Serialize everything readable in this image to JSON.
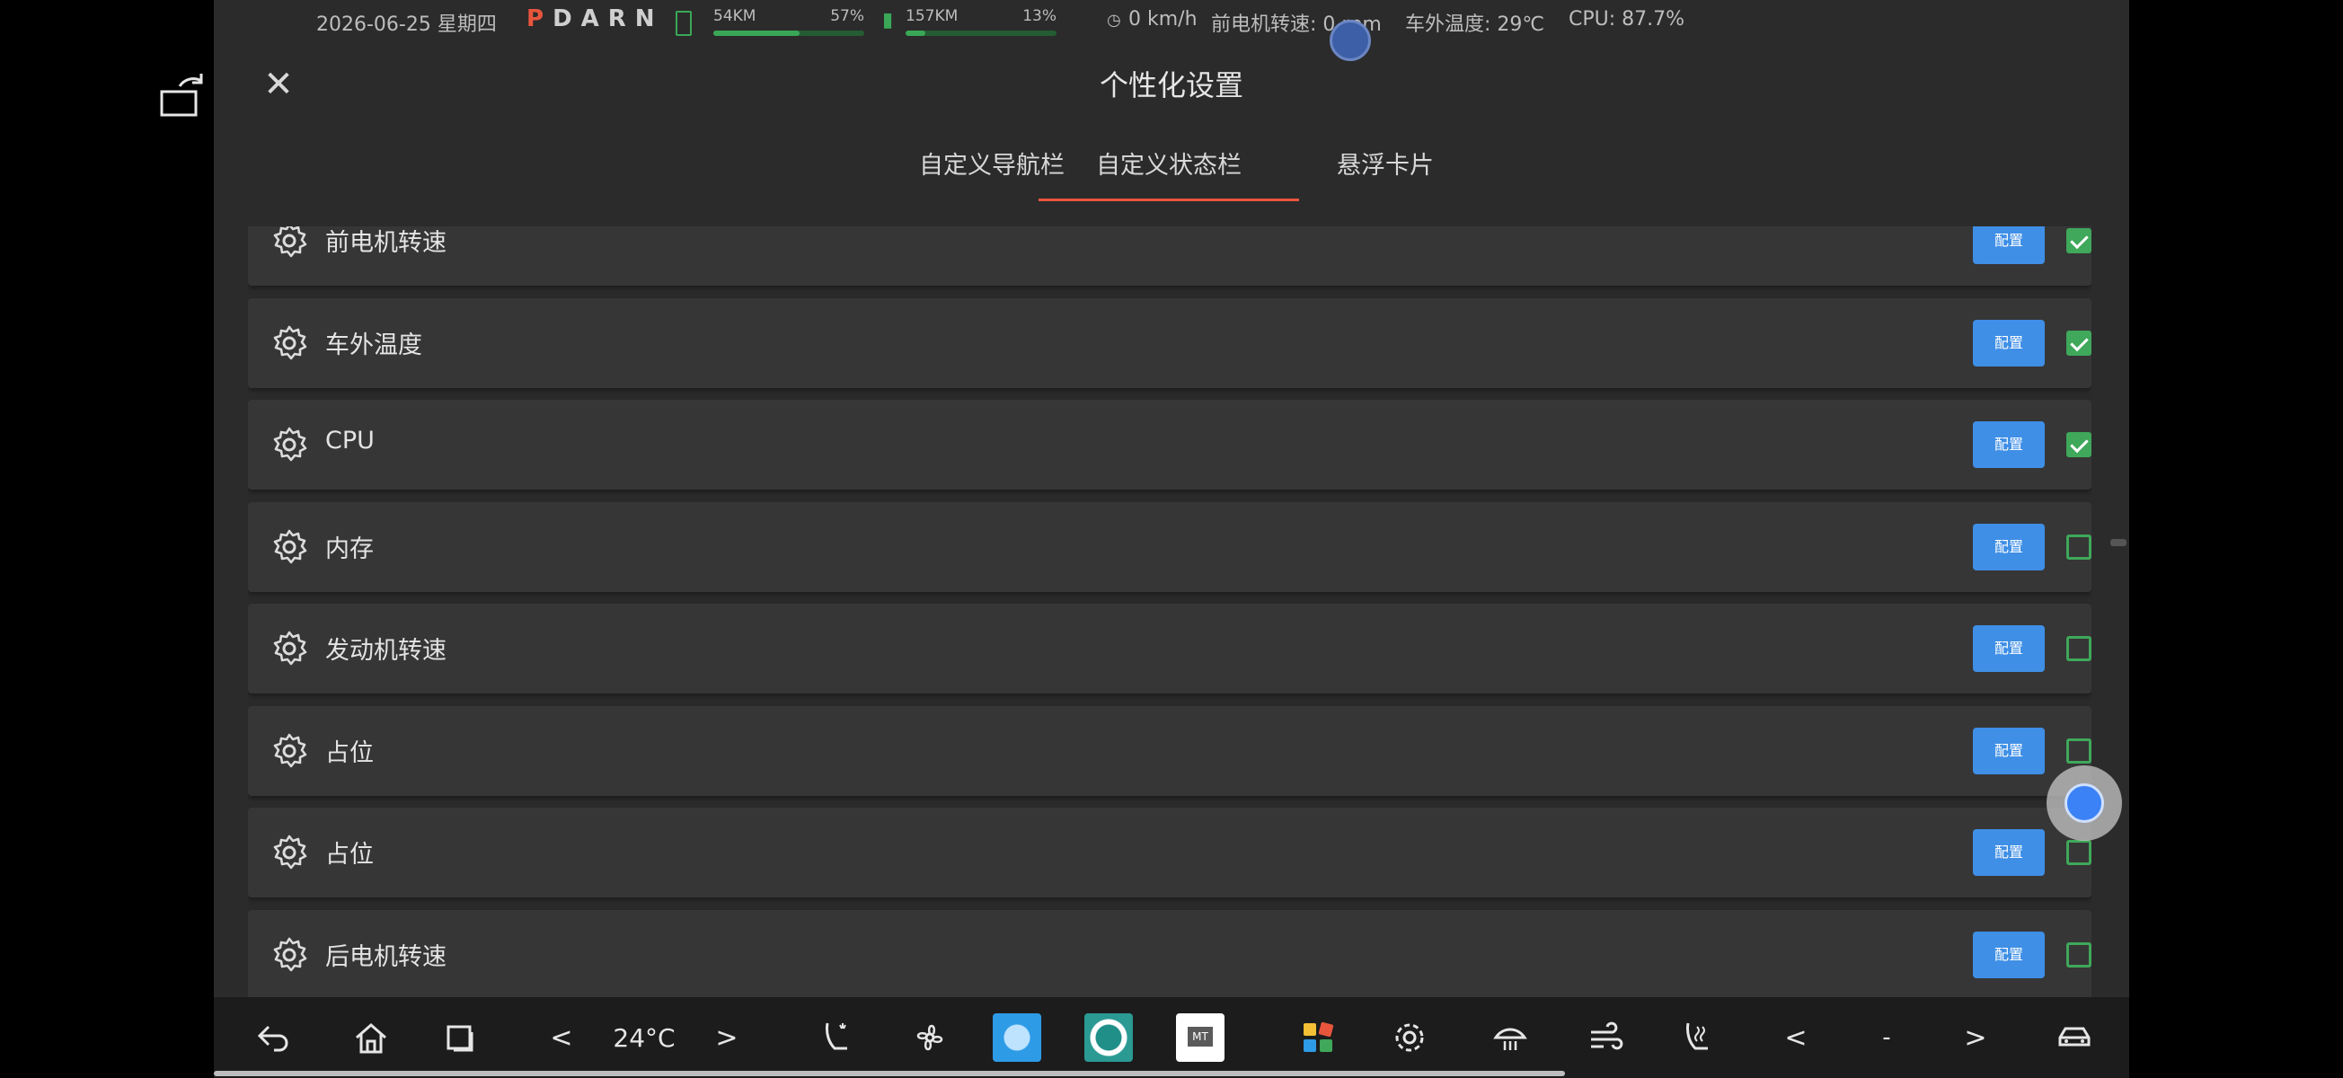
{
  "status_bar": {
    "datetime": "2026-06-25 星期四",
    "gear": {
      "active": "P",
      "others": "DARN"
    },
    "battery1": {
      "range": "54KM",
      "percent_label": "57%",
      "level": 0.57
    },
    "battery2": {
      "range": "157KM",
      "percent_label": "13%",
      "level": 0.13
    },
    "speed_icon": "speedometer-icon",
    "speed": "0 km/h",
    "front_motor": "前电机转速: 0 rpm",
    "outside_temp": "车外温度: 29℃",
    "cpu": "CPU: 87.7%"
  },
  "header": {
    "close_icon": "close-icon",
    "title": "个性化设置"
  },
  "tabs": [
    {
      "label": "自定义导航栏",
      "active": false
    },
    {
      "label": "自定义状态栏",
      "active": true
    },
    {
      "label": "悬浮卡片",
      "active": false
    }
  ],
  "items": [
    {
      "label": "前电机转速",
      "config_label": "配置",
      "checked": true
    },
    {
      "label": "车外温度",
      "config_label": "配置",
      "checked": true
    },
    {
      "label": "CPU",
      "config_label": "配置",
      "checked": true
    },
    {
      "label": "内存",
      "config_label": "配置",
      "checked": false
    },
    {
      "label": "发动机转速",
      "config_label": "配置",
      "checked": false
    },
    {
      "label": "占位",
      "config_label": "配置",
      "checked": false
    },
    {
      "label": "占位",
      "config_label": "配置",
      "checked": false
    },
    {
      "label": "后电机转速",
      "config_label": "配置",
      "checked": false
    }
  ],
  "dock": {
    "back_icon": "back-icon",
    "home_icon": "home-icon",
    "recents_icon": "recents-icon",
    "temp_left": "<",
    "temperature": "24°C",
    "temp_right": ">",
    "seat_icon": "seat-heat-icon",
    "fan_icon": "fan-icon",
    "app1_icon": "weather-app-icon",
    "app2_icon": "camera-app-icon",
    "app3_icon": "mt-app-icon",
    "apps_icon": "app-grid-icon",
    "settings_icon": "settings-icon",
    "defrost_front_icon": "front-defrost-icon",
    "air_flow_icon": "airflow-icon",
    "seat_vent_icon": "seat-vent-icon",
    "right_left": "<",
    "right_value": "-",
    "right_right": ">",
    "car_icon": "car-icon"
  },
  "colors": {
    "accent": "#e8553d",
    "primary": "#3f8fe6",
    "check": "#3fa85a",
    "battery": "#3aa757"
  }
}
